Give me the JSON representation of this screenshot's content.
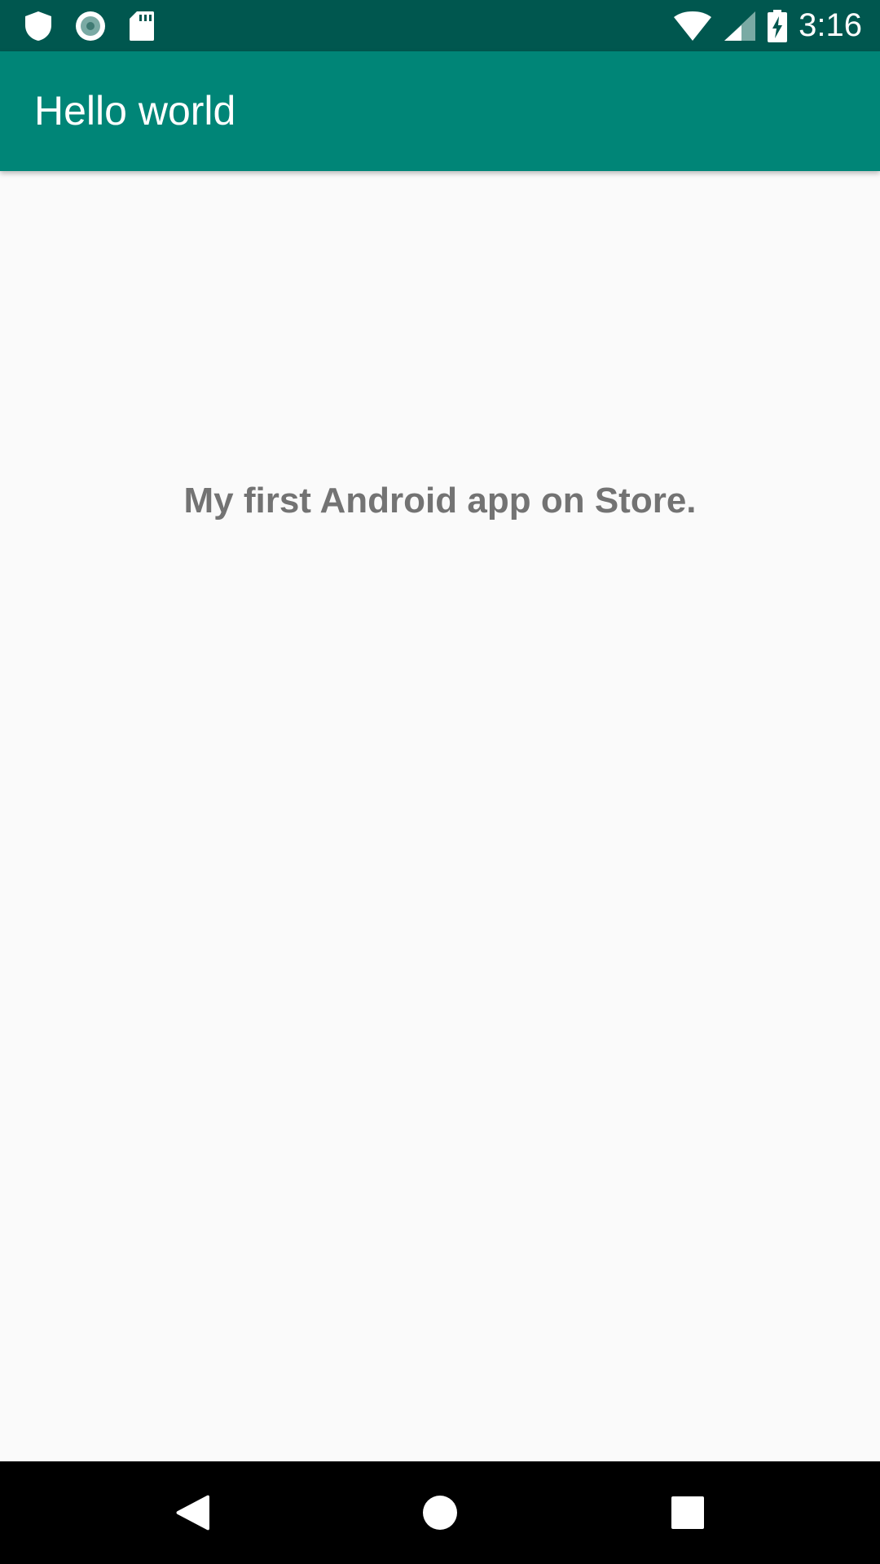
{
  "status_bar": {
    "time": "3:16",
    "left_icons": [
      "shield-icon",
      "record-icon",
      "sd-card-icon"
    ],
    "right_icons": [
      "wifi-icon",
      "cell-signal-icon",
      "battery-charging-icon"
    ]
  },
  "app_bar": {
    "title": "Hello world"
  },
  "main": {
    "message": "My first Android app on Store."
  },
  "nav_bar": {
    "buttons": [
      "back-icon",
      "home-icon",
      "recents-icon"
    ]
  },
  "colors": {
    "status_bar": "#00574f",
    "app_bar": "#008577",
    "background": "#fafafa",
    "text": "#737373",
    "nav_bar": "#000000"
  }
}
